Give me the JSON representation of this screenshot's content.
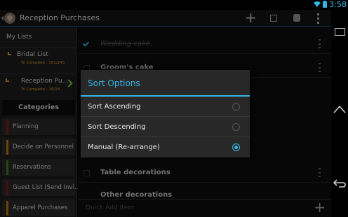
{
  "status": {
    "time": "3:58"
  },
  "actionbar": {
    "title": "Reception Purchases"
  },
  "sidebar": {
    "header": "My Lists",
    "lists": [
      {
        "name": "Bridal List",
        "progress": "To Complete : 101/143"
      },
      {
        "name": "Reception Pu...",
        "progress": "To Complete : 16/18"
      }
    ],
    "categories_header": "Categories",
    "categories": [
      {
        "label": "Planning",
        "color": "#8b1a1a"
      },
      {
        "label": "Decide on Personnel",
        "color": "#c07a10"
      },
      {
        "label": "Reservations",
        "color": "#3a8a20"
      },
      {
        "label": "Guest List (Send Invi...",
        "color": "#8b1a1a"
      },
      {
        "label": "Apparel Purchases",
        "color": "#c07a10"
      }
    ]
  },
  "main": {
    "items": [
      {
        "text": "Wedding cake",
        "done": true
      },
      {
        "text": "Groom's cake",
        "done": false
      },
      {
        "text": "Table decorations",
        "done": false
      },
      {
        "text": "Other decorations",
        "done": false
      }
    ],
    "quick_add": "Quick Add Item"
  },
  "dialog": {
    "title": "Sort Options",
    "options": [
      {
        "label": "Sort Ascending",
        "selected": false
      },
      {
        "label": "Sort Descending",
        "selected": false
      },
      {
        "label": "Manual (Re-arrange)",
        "selected": true
      }
    ]
  },
  "colors": {
    "accent": "#33b5e5",
    "chevron": "#7ed321"
  }
}
